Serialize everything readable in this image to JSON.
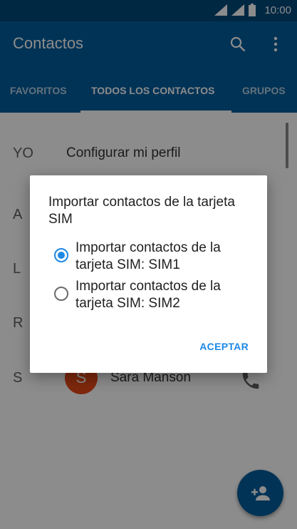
{
  "status_bar": {
    "time": "10:00"
  },
  "app_bar": {
    "title": "Contactos"
  },
  "tabs": [
    {
      "label": "FAVORITOS",
      "active": false
    },
    {
      "label": "TODOS LOS CONTACTOS",
      "active": true
    },
    {
      "label": "GRUPOS",
      "active": false
    }
  ],
  "list": {
    "profile_letter": "YO",
    "profile_text": "Configurar mi perfil",
    "section_letters": [
      "A",
      "L",
      "R",
      "S"
    ],
    "visible_contact": {
      "initial": "S",
      "name": "Sara Manson"
    }
  },
  "dialog": {
    "title": "Importar contactos de la tarjeta SIM",
    "options": [
      {
        "label": "Importar contactos de la tarjeta SIM: SIM1",
        "checked": true
      },
      {
        "label": "Importar contactos de la tarjeta SIM: SIM2",
        "checked": false
      }
    ],
    "confirm_label": "ACEPTAR"
  },
  "colors": {
    "status_bar": "#01497b",
    "app_bar": "#025d9d",
    "accent": "#1e88e5",
    "avatar": "#e64a19"
  },
  "icons": {
    "search": "search-icon",
    "overflow": "more-vert-icon",
    "phone": "phone-icon",
    "add_contact": "add-contact-icon"
  }
}
